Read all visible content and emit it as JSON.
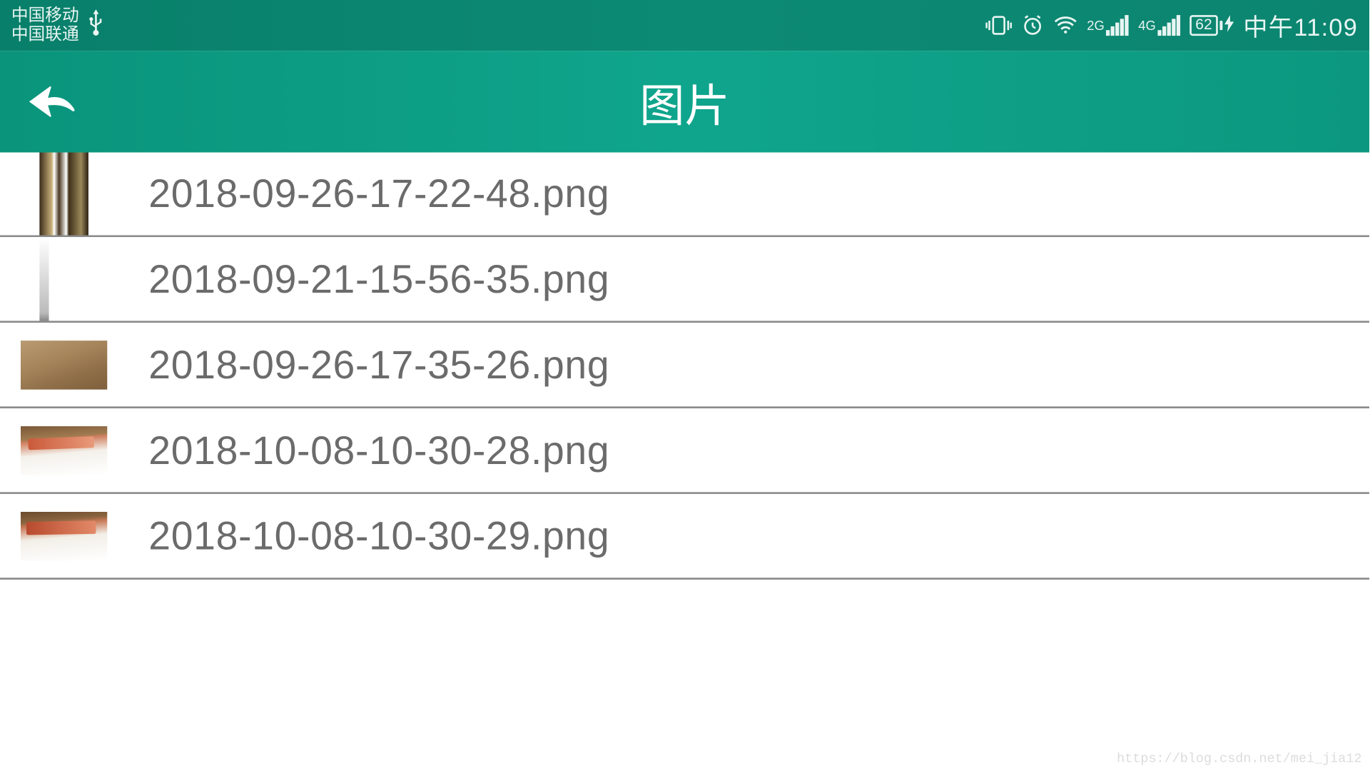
{
  "status_bar": {
    "carrier1": "中国移动",
    "carrier2": "中国联通",
    "battery_pct": "62",
    "time": "中午11:09",
    "signal1_label": "2G",
    "signal2_label": "4G"
  },
  "header": {
    "title": "图片"
  },
  "files": [
    {
      "name": "2018-09-26-17-22-48.png",
      "thumb_class": "t1"
    },
    {
      "name": "2018-09-21-15-56-35.png",
      "thumb_class": "t2"
    },
    {
      "name": "2018-09-26-17-35-26.png",
      "thumb_class": "t3"
    },
    {
      "name": "2018-10-08-10-30-28.png",
      "thumb_class": "t4"
    },
    {
      "name": "2018-10-08-10-30-29.png",
      "thumb_class": "t5"
    }
  ],
  "watermark": "https://blog.csdn.net/mei_jia12"
}
